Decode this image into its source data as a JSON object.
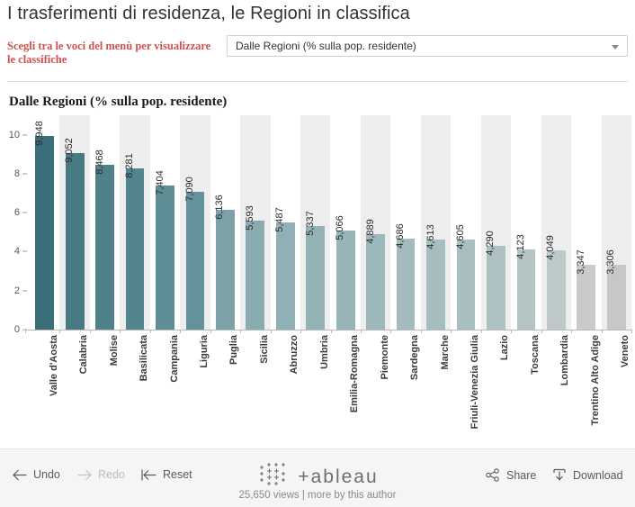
{
  "header": {
    "title": "I trasferimenti di residenza, le Regioni in classifica",
    "subtitle": "Scegli tra le voci del menù per visualizzare le classifiche",
    "filter": {
      "selected": "Dalle Regioni (% sulla pop. residente)",
      "caret_icon": "chevron-down-icon"
    }
  },
  "chart_data": {
    "type": "bar",
    "title": "Dalle Regioni (% sulla pop. residente)",
    "xlabel": "",
    "ylabel": "",
    "ylim": [
      0,
      11
    ],
    "yticks": [
      0,
      2,
      4,
      6,
      8,
      10
    ],
    "grid": false,
    "legend": null,
    "banding": "alternating-light-gray",
    "categories": [
      "Valle d'Aosta",
      "Calabria",
      "Molise",
      "Basilicata",
      "Campania",
      "Liguria",
      "Puglia",
      "Sicilia",
      "Abruzzo",
      "Umbria",
      "Emilia-Romagna",
      "Piemonte",
      "Sardegna",
      "Marche",
      "Friuli-Venezia Giulia",
      "Lazio",
      "Toscana",
      "Lombardia",
      "Trentino Alto Adige",
      "Veneto"
    ],
    "values": [
      9.948,
      9.052,
      8.468,
      8.281,
      7.404,
      7.09,
      6.136,
      5.593,
      5.487,
      5.337,
      5.066,
      4.889,
      4.686,
      4.613,
      4.605,
      4.29,
      4.123,
      4.049,
      3.347,
      3.306
    ],
    "value_labels": [
      "9,948",
      "9,052",
      "8,468",
      "8,281",
      "7,404",
      "7,090",
      "6,136",
      "5,593",
      "5,487",
      "5,337",
      "5,066",
      "4,889",
      "4,686",
      "4,613",
      "4,605",
      "4,290",
      "4,123",
      "4,049",
      "3,347",
      "3,306"
    ],
    "colors": [
      "#3a6e78",
      "#487a84",
      "#4e818a",
      "#53858e",
      "#5d8d95",
      "#63929a",
      "#7ca1a7",
      "#8aacb1",
      "#8fb0b4",
      "#93b2b6",
      "#97b5b9",
      "#9cb8bb",
      "#a3bbbe",
      "#a6bdc0",
      "#a8bec1",
      "#adc1c3",
      "#b4c4c5",
      "#bcc8c9",
      "#c9cbca",
      "#c6c8c7"
    ]
  },
  "toolbar": {
    "undo_label": "Undo",
    "redo_label": "Redo",
    "reset_label": "Reset",
    "share_label": "Share",
    "download_label": "Download",
    "brand_word": "+ableau",
    "views_text": "25,650 views | more by this author"
  }
}
